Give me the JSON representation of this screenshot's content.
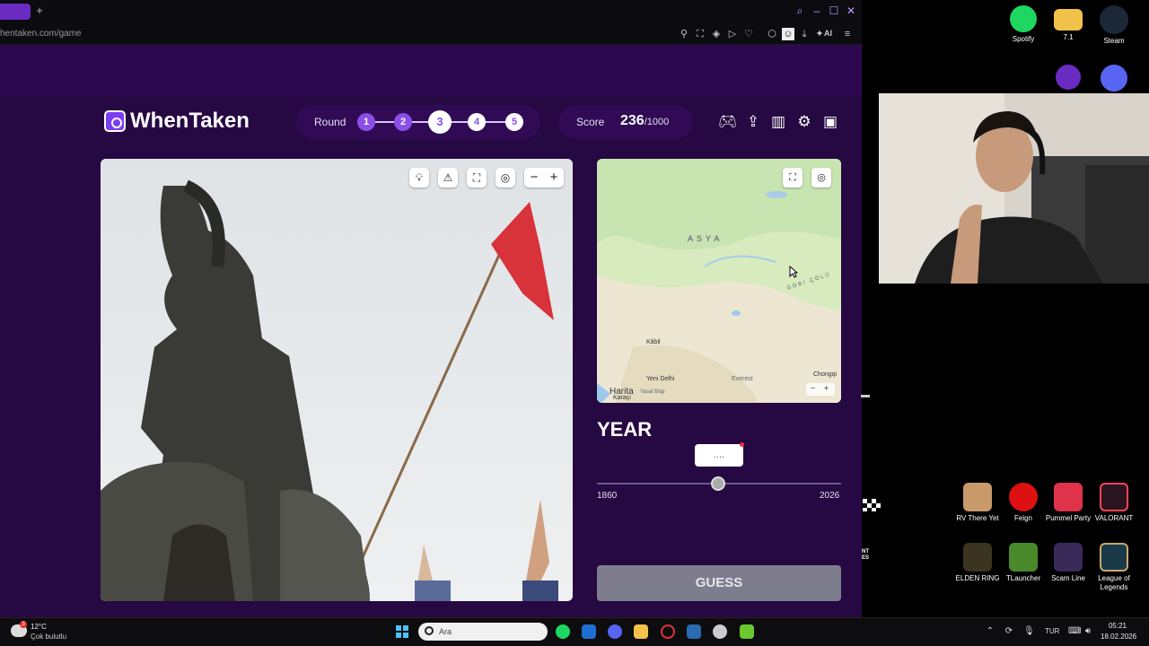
{
  "browser": {
    "url": "hentaken.com/game",
    "new_tab": "+",
    "ai_label": "AI"
  },
  "header": {
    "brand": "WhenTaken",
    "round_label": "Round",
    "rounds": [
      "1",
      "2",
      "3",
      "4",
      "5"
    ],
    "current_round": 3,
    "score_label": "Score",
    "score": "236",
    "score_max": "/1000"
  },
  "map": {
    "region_label": "ASYA",
    "gobi_label": "GOBI ÇÖLÜ",
    "labels": [
      "Kâbil",
      "Yeni Delhi",
      "Everest",
      "Chongqi",
      "Karaçi"
    ],
    "attribution": "Harita",
    "legal": "Yasal Bilgi",
    "zoom_out": "−",
    "zoom_in": "+"
  },
  "year": {
    "title": "YEAR",
    "value": "....",
    "min": "1860",
    "max": "2026",
    "guess_label": "GUESS"
  },
  "desktop": {
    "icons_top": [
      {
        "label": "Spotify",
        "color": "#1ed760"
      },
      {
        "label": "7.1",
        "color": "#f2c14a"
      },
      {
        "label": "Steam",
        "color": "#1b2838"
      }
    ],
    "icons_mid": [
      {
        "label": "",
        "color": "#6a2bc2"
      },
      {
        "label": "",
        "color": "#5865f2"
      }
    ],
    "icons_bottom1": [
      {
        "label": "RV There Yet",
        "color": "#c89a6a"
      },
      {
        "label": "Feign",
        "color": "#d11"
      },
      {
        "label": "Pummel Party",
        "color": "#e0324a"
      },
      {
        "label": "VALORANT",
        "color": "#2a1420"
      }
    ],
    "icons_bottom2": [
      {
        "label": "ELDEN RING",
        "color": "#3a3420"
      },
      {
        "label": "TLauncher",
        "color": "#4a8a2a"
      },
      {
        "label": "Scam Line",
        "color": "#3a2a5a"
      },
      {
        "label": "League of Legends",
        "color": "#1a3a4a"
      }
    ],
    "side_text": "NT\nES"
  },
  "taskbar": {
    "temperature": "12°C",
    "condition": "Çok bulutlu",
    "weather_badge": "3",
    "search_placeholder": "Ara",
    "language": "TUR",
    "time": "05:21",
    "date": "18.02.2026"
  }
}
